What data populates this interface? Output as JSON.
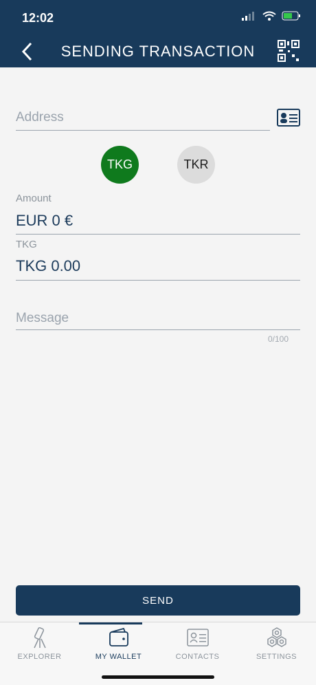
{
  "status_bar": {
    "time": "12:02"
  },
  "header": {
    "title": "SENDING TRANSACTION"
  },
  "form": {
    "address_placeholder": "Address",
    "tokens": [
      {
        "label": "TKG",
        "selected": true,
        "color": "#0f7a1d"
      },
      {
        "label": "TKR",
        "selected": false,
        "color": "#dcdcdc"
      }
    ],
    "amount_label": "Amount",
    "amount_value": "EUR 0 €",
    "token_label": "TKG",
    "token_value": "TKG 0.00",
    "message_placeholder": "Message",
    "message_counter": "0/100"
  },
  "actions": {
    "send_label": "SEND"
  },
  "tabbar": {
    "items": [
      {
        "label": "EXPLORER",
        "icon": "telescope-icon"
      },
      {
        "label": "MY WALLET",
        "icon": "wallet-icon",
        "active": true
      },
      {
        "label": "CONTACTS",
        "icon": "contact-card-icon"
      },
      {
        "label": "SETTINGS",
        "icon": "gears-icon"
      }
    ]
  },
  "colors": {
    "primary": "#183a5b",
    "accent_green": "#0f7a1d",
    "background": "#f4f4f4"
  }
}
